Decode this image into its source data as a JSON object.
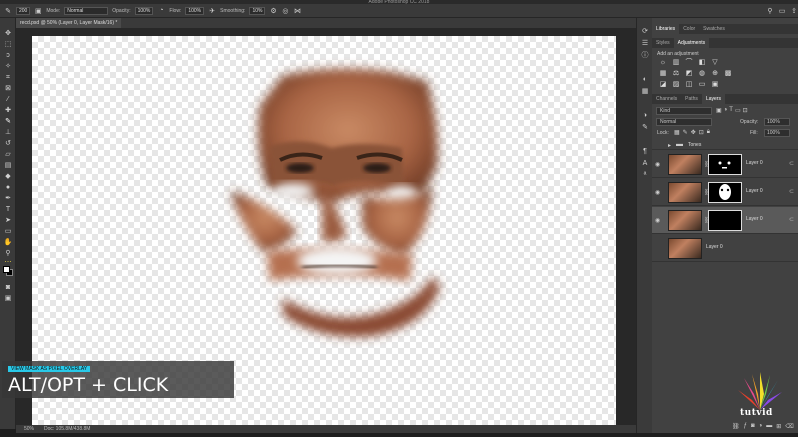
{
  "app": {
    "title": "Adobe Photoshop CC 2018"
  },
  "options": {
    "mode_label": "Mode:",
    "mode_value": "Normal",
    "opacity_label": "Opacity:",
    "opacity_value": "100%",
    "flow_label": "Flow:",
    "flow_value": "100%",
    "smoothing_label": "Smoothing:",
    "smoothing_value": "10%",
    "brush_size": "200"
  },
  "document": {
    "tab_label": "recd.psd @ 50% (Layer 0, Layer Mask/16) *",
    "zoom": "50%",
    "doc_info": "Doc: 105.8M/438.8M"
  },
  "panels": {
    "top_tabs": [
      "Libraries",
      "Color",
      "Swatches"
    ],
    "sub_tabs": [
      "Styles",
      "Adjustments"
    ],
    "add_adjustment": "Add an adjustment",
    "layer_tabs": [
      "Channels",
      "Paths",
      "Layers"
    ],
    "kind_label": "Kind",
    "blend_mode": "Normal",
    "opacity_label": "Opacity:",
    "opacity_value": "100%",
    "lock_label": "Lock:",
    "fill_label": "Fill:",
    "fill_value": "100%",
    "group_name": "Tones",
    "layers": [
      {
        "name": "Layer 0",
        "has_mask": true,
        "selected": false
      },
      {
        "name": "Layer 0",
        "has_mask": true,
        "selected": false
      },
      {
        "name": "Layer 0",
        "has_mask": true,
        "selected": true
      },
      {
        "name": "Layer 0",
        "has_mask": false,
        "selected": false
      }
    ]
  },
  "caption": {
    "sub": "VIEW MASK AS PIXEL OVERLAY",
    "main": "ALT/OPT + CLICK"
  },
  "brand": {
    "name": "tutvid"
  },
  "colors": {
    "accent": "#29c9e8",
    "foreground": "#ffffff",
    "background": "#000000"
  }
}
